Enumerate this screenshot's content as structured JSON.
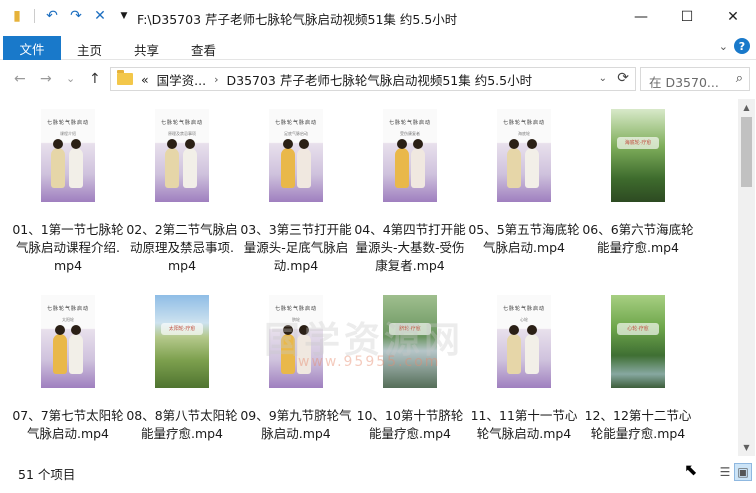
{
  "window": {
    "title": "F:\\D35703 芹子老师七脉轮气脉启动视频51集 约5.5小时",
    "qat_icons": [
      "folder-icon",
      "undo-icon",
      "redo-icon",
      "delete-icon",
      "customize-icon"
    ],
    "controls": {
      "minimize": "—",
      "maximize": "☐",
      "close": "✕"
    }
  },
  "ribbon": {
    "file_tab": "文件",
    "tabs": [
      "主页",
      "共享",
      "查看"
    ],
    "help": "?"
  },
  "nav": {
    "back": "←",
    "forward": "→",
    "recent": "⌄",
    "up": "↑",
    "breadcrumb_prefix": "«",
    "crumbs": [
      "国学资...",
      "D35703 芹子老师七脉轮气脉启动视频51集 约5.5小时"
    ],
    "search_placeholder": "在 D3570...",
    "search_icon": "⌕",
    "refresh_icon": "⟳"
  },
  "files": [
    {
      "name": "01、1第一节七脉轮气脉启动课程介绍.mp4",
      "thumb": "purple",
      "caption": "七脉轮气脉启动",
      "sub": "课程介绍"
    },
    {
      "name": "02、2第二节气脉启动原理及禁忌事项.mp4",
      "thumb": "purple",
      "caption": "七脉轮气脉启动",
      "sub": "原理及禁忌事项"
    },
    {
      "name": "03、3第三节打开能量源头-足底气脉启动.mp4",
      "thumb": "purple2",
      "caption": "七脉轮气脉启动",
      "sub": "足底气脉启动"
    },
    {
      "name": "04、4第四节打开能量源头-大基数-受伤康复者.mp4",
      "thumb": "purple2",
      "caption": "七脉轮气脉启动",
      "sub": "受伤康复者"
    },
    {
      "name": "05、5第五节海底轮气脉启动.mp4",
      "thumb": "purple",
      "caption": "七脉轮气脉启动",
      "sub": "海底轮"
    },
    {
      "name": "06、6第六节海底轮能量疗愈.mp4",
      "thumb": "nature",
      "caption": "海底轮·疗愈",
      "sub": ""
    },
    {
      "name": "07、7第七节太阳轮气脉启动.mp4",
      "thumb": "purple",
      "caption": "七脉轮气脉启动",
      "sub": "太阳轮"
    },
    {
      "name": "08、8第八节太阳轮能量疗愈.mp4",
      "thumb": "nature2",
      "caption": "太阳轮·疗愈",
      "sub": ""
    },
    {
      "name": "09、9第九节脐轮气脉启动.mp4",
      "thumb": "purple",
      "caption": "七脉轮气脉启动",
      "sub": "脐轮"
    },
    {
      "name": "10、10第十节脐轮能量疗愈.mp4",
      "thumb": "nature3",
      "caption": "脐轮·疗愈",
      "sub": ""
    },
    {
      "name": "11、11第十一节心轮气脉启动.mp4",
      "thumb": "purple",
      "caption": "七脉轮气脉启动",
      "sub": "心轮"
    },
    {
      "name": "12、12第十二节心轮能量疗愈.mp4",
      "thumb": "nature4",
      "caption": "心轮·疗愈",
      "sub": ""
    }
  ],
  "watermark": {
    "line1": "国学资源网",
    "line2": "www.95955.com"
  },
  "status": {
    "item_count": "51 个项目"
  }
}
